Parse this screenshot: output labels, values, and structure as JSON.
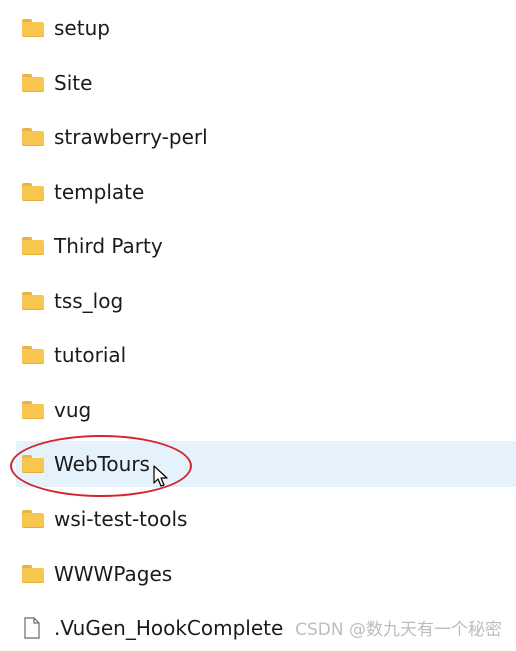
{
  "items": [
    {
      "name": "setup",
      "type": "folder"
    },
    {
      "name": "Site",
      "type": "folder"
    },
    {
      "name": "strawberry-perl",
      "type": "folder"
    },
    {
      "name": "template",
      "type": "folder"
    },
    {
      "name": "Third Party",
      "type": "folder"
    },
    {
      "name": "tss_log",
      "type": "folder"
    },
    {
      "name": "tutorial",
      "type": "folder"
    },
    {
      "name": "vug",
      "type": "folder"
    },
    {
      "name": "WebTours",
      "type": "folder",
      "selected": true,
      "annotated": true
    },
    {
      "name": "wsi-test-tools",
      "type": "folder"
    },
    {
      "name": "WWWPages",
      "type": "folder"
    },
    {
      "name": ".VuGen_HookComplete",
      "type": "file"
    }
  ],
  "watermark": "CSDN @数九天有一个秘密",
  "colors": {
    "selected_row": "#e5f1fb",
    "annotation_ring": "#d2262a",
    "folder": "#f6c64f"
  },
  "icons": {
    "folder": "folder-icon",
    "file": "file-icon",
    "cursor": "mouse-pointer-icon"
  }
}
